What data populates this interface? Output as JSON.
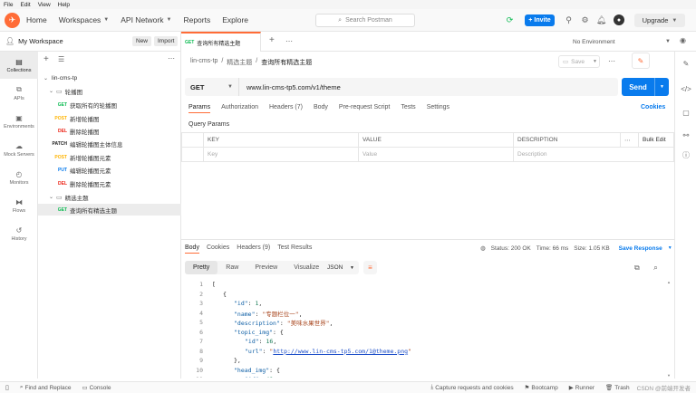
{
  "menubar": {
    "items": [
      "File",
      "Edit",
      "View",
      "Help"
    ]
  },
  "header": {
    "nav": [
      "Home",
      "Workspaces",
      "API Network",
      "Reports",
      "Explore"
    ],
    "search_placeholder": "Search Postman",
    "invite_label": "Invite",
    "upgrade_label": "Upgrade"
  },
  "workspace": {
    "title": "My Workspace",
    "new_label": "New",
    "import_label": "Import"
  },
  "rail": [
    {
      "label": "Collections",
      "icon": "collections-icon"
    },
    {
      "label": "APIs",
      "icon": "apis-icon"
    },
    {
      "label": "Environments",
      "icon": "environments-icon"
    },
    {
      "label": "Mock Servers",
      "icon": "mock-servers-icon"
    },
    {
      "label": "Monitors",
      "icon": "monitors-icon"
    },
    {
      "label": "Flows",
      "icon": "flows-icon"
    },
    {
      "label": "History",
      "icon": "history-icon"
    }
  ],
  "tree": {
    "collection": "lin-cms-tp",
    "folder1": "轮播图",
    "items1": [
      {
        "method": "GET",
        "name": "获取所有的轮播图"
      },
      {
        "method": "POST",
        "name": "新增轮播图"
      },
      {
        "method": "DEL",
        "name": "删除轮播图"
      },
      {
        "method": "PATCH",
        "name": "编辑轮播图主体信息"
      },
      {
        "method": "POST",
        "name": "新增轮播图元素"
      },
      {
        "method": "PUT",
        "name": "编辑轮播图元素"
      },
      {
        "method": "DEL",
        "name": "删除轮播图元素"
      }
    ],
    "folder2": "精选主题",
    "items2": [
      {
        "method": "GET",
        "name": "查询所有精选主题"
      }
    ]
  },
  "tab": {
    "method": "GET",
    "name": "查询所有精选主题"
  },
  "environment": "No Environment",
  "breadcrumb": {
    "collection": "lin-cms-tp",
    "folder": "精选主题",
    "request": "查询所有精选主题"
  },
  "save_label": "Save",
  "request": {
    "method": "GET",
    "url": "www.lin-cms-tp5.com/v1/theme",
    "send_label": "Send"
  },
  "request_tabs": [
    "Params",
    "Authorization",
    "Headers (7)",
    "Body",
    "Pre-request Script",
    "Tests",
    "Settings"
  ],
  "cookies_label": "Cookies",
  "query_params_label": "Query Params",
  "params_table": {
    "headers": [
      "KEY",
      "VALUE",
      "DESCRIPTION"
    ],
    "bulk_edit": "Bulk Edit",
    "placeholders": [
      "Key",
      "Value",
      "Description"
    ]
  },
  "response_tabs": [
    "Body",
    "Cookies",
    "Headers (9)",
    "Test Results"
  ],
  "status": {
    "status": "Status: 200 OK",
    "time": "Time: 66 ms",
    "size": "Size: 1.05 KB",
    "save_response": "Save Response"
  },
  "response_view": {
    "modes": [
      "Pretty",
      "Raw",
      "Preview",
      "Visualize"
    ],
    "format": "JSON"
  },
  "footer": {
    "find_replace": "Find and Replace",
    "console": "Console",
    "capture": "Capture requests and cookies",
    "bootcamp": "Bootcamp",
    "runner": "Runner",
    "trash": "Trash",
    "watermark": "CSDN @前端开发者"
  },
  "accent": "#ff6c37",
  "primary": "#097bed"
}
